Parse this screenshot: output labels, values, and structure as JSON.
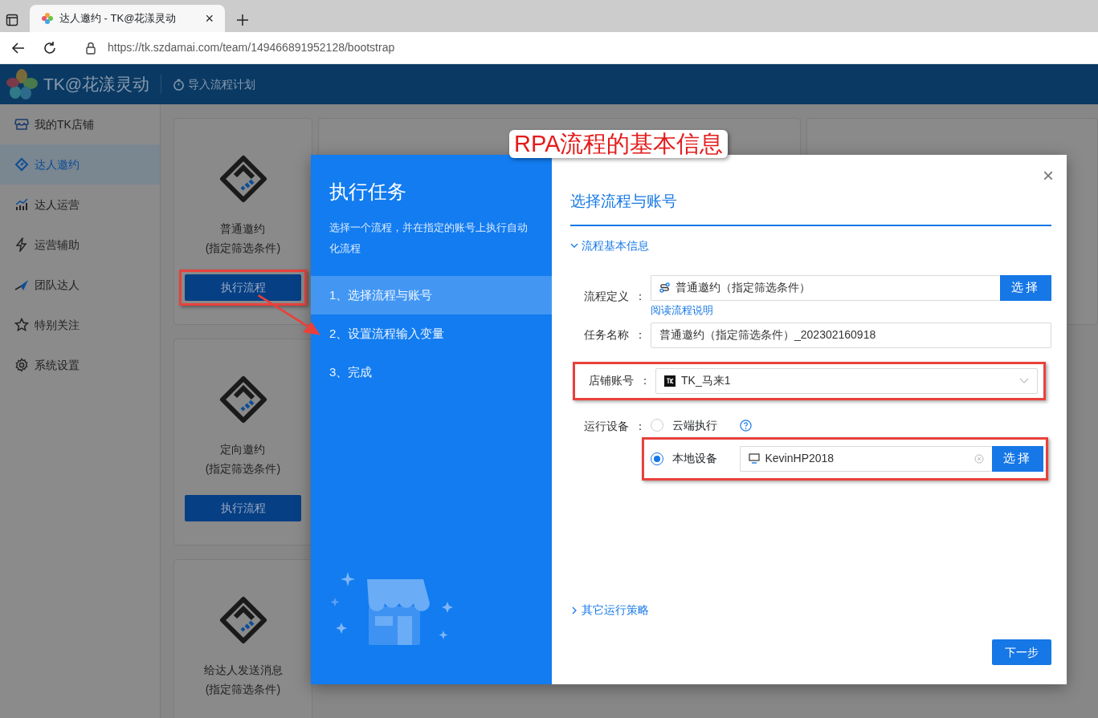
{
  "browser": {
    "tab_title": "达人邀约 - TK@花漾灵动",
    "tab_close": "×",
    "url": "https://tk.szdamai.com/team/149466891952128/bootstrap"
  },
  "app": {
    "brand": "TK@花漾灵动",
    "header_action": "导入流程计划"
  },
  "sidebar": {
    "items": [
      {
        "label": "我的TK店铺",
        "selected": false
      },
      {
        "label": "达人邀约",
        "selected": true
      },
      {
        "label": "达人运营",
        "selected": false
      },
      {
        "label": "运营辅助",
        "selected": false
      },
      {
        "label": "团队达人",
        "selected": false
      },
      {
        "label": "特别关注",
        "selected": false
      },
      {
        "label": "系统设置",
        "selected": false
      }
    ]
  },
  "cards": [
    {
      "title": "普通邀约",
      "subtitle": "(指定筛选条件)",
      "button": "执行流程"
    },
    {
      "title": "定向邀约",
      "subtitle": "(指定筛选条件)",
      "button": "执行流程"
    },
    {
      "title": "给达人发送消息",
      "subtitle": "(指定筛选条件)"
    }
  ],
  "modal": {
    "close": "×",
    "title": "执行任务",
    "description": "选择一个流程，并在指定的账号上执行自动化流程",
    "steps": [
      {
        "label": "1、选择流程与账号",
        "selected": true
      },
      {
        "label": "2、设置流程输入变量",
        "selected": false
      },
      {
        "label": "3、完成",
        "selected": false
      }
    ],
    "heading": "选择流程与账号",
    "section": {
      "label": "流程基本信息",
      "expanded": true
    },
    "fields": [
      {
        "kind": "select-button",
        "label": "流程定义",
        "separator": "：",
        "value": "普通邀约（指定筛选条件）",
        "button": "选择",
        "link": "阅读流程说明"
      },
      {
        "kind": "text",
        "label": "任务名称",
        "separator": "：",
        "value": "普通邀约（指定筛选条件）_202302160918"
      },
      {
        "kind": "dropdown",
        "label": "店铺账号",
        "separator": "：",
        "value": "TK_马来1"
      },
      {
        "kind": "radios",
        "label": "运行设备",
        "separator": "：",
        "options": [
          {
            "label": "云端执行",
            "selected": false,
            "help": true
          },
          {
            "label": "本地设备",
            "selected": true,
            "value": "KevinHP2018",
            "button": "选择"
          }
        ]
      }
    ],
    "more": {
      "label": "其它运行策略",
      "expanded": false
    },
    "next_button": "下一步"
  },
  "annotation": {
    "title": "RPA流程的基本信息"
  }
}
